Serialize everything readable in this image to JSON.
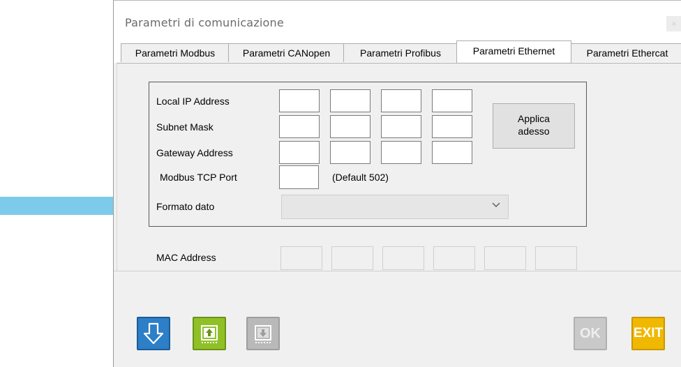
{
  "window": {
    "title": "Parametri di comunicazione",
    "close_label": "×"
  },
  "tabs": [
    {
      "label": "Parametri Modbus",
      "active": false
    },
    {
      "label": "Parametri CANopen",
      "active": false
    },
    {
      "label": "Parametri Profibus",
      "active": false
    },
    {
      "label": "Parametri Ethernet",
      "active": true
    },
    {
      "label": "Parametri Ethercat",
      "active": false
    }
  ],
  "ethernet": {
    "local_ip_label": "Local IP Address",
    "subnet_label": "Subnet Mask",
    "gateway_label": "Gateway Address",
    "modbus_port_label": "Modbus TCP Port",
    "modbus_port_default": "(Default 502)",
    "format_label": "Formato dato",
    "format_value": "",
    "apply_label_1": "Applica",
    "apply_label_2": "adesso",
    "mac_label": "MAC Address"
  },
  "toolbar": {
    "ok_label": "OK",
    "exit_label": "EXIT"
  },
  "colors": {
    "arrow": "#7dcbea",
    "download": "#2d7fc7",
    "upload_green": "#8fc127",
    "exit_yellow": "#f0b800"
  }
}
